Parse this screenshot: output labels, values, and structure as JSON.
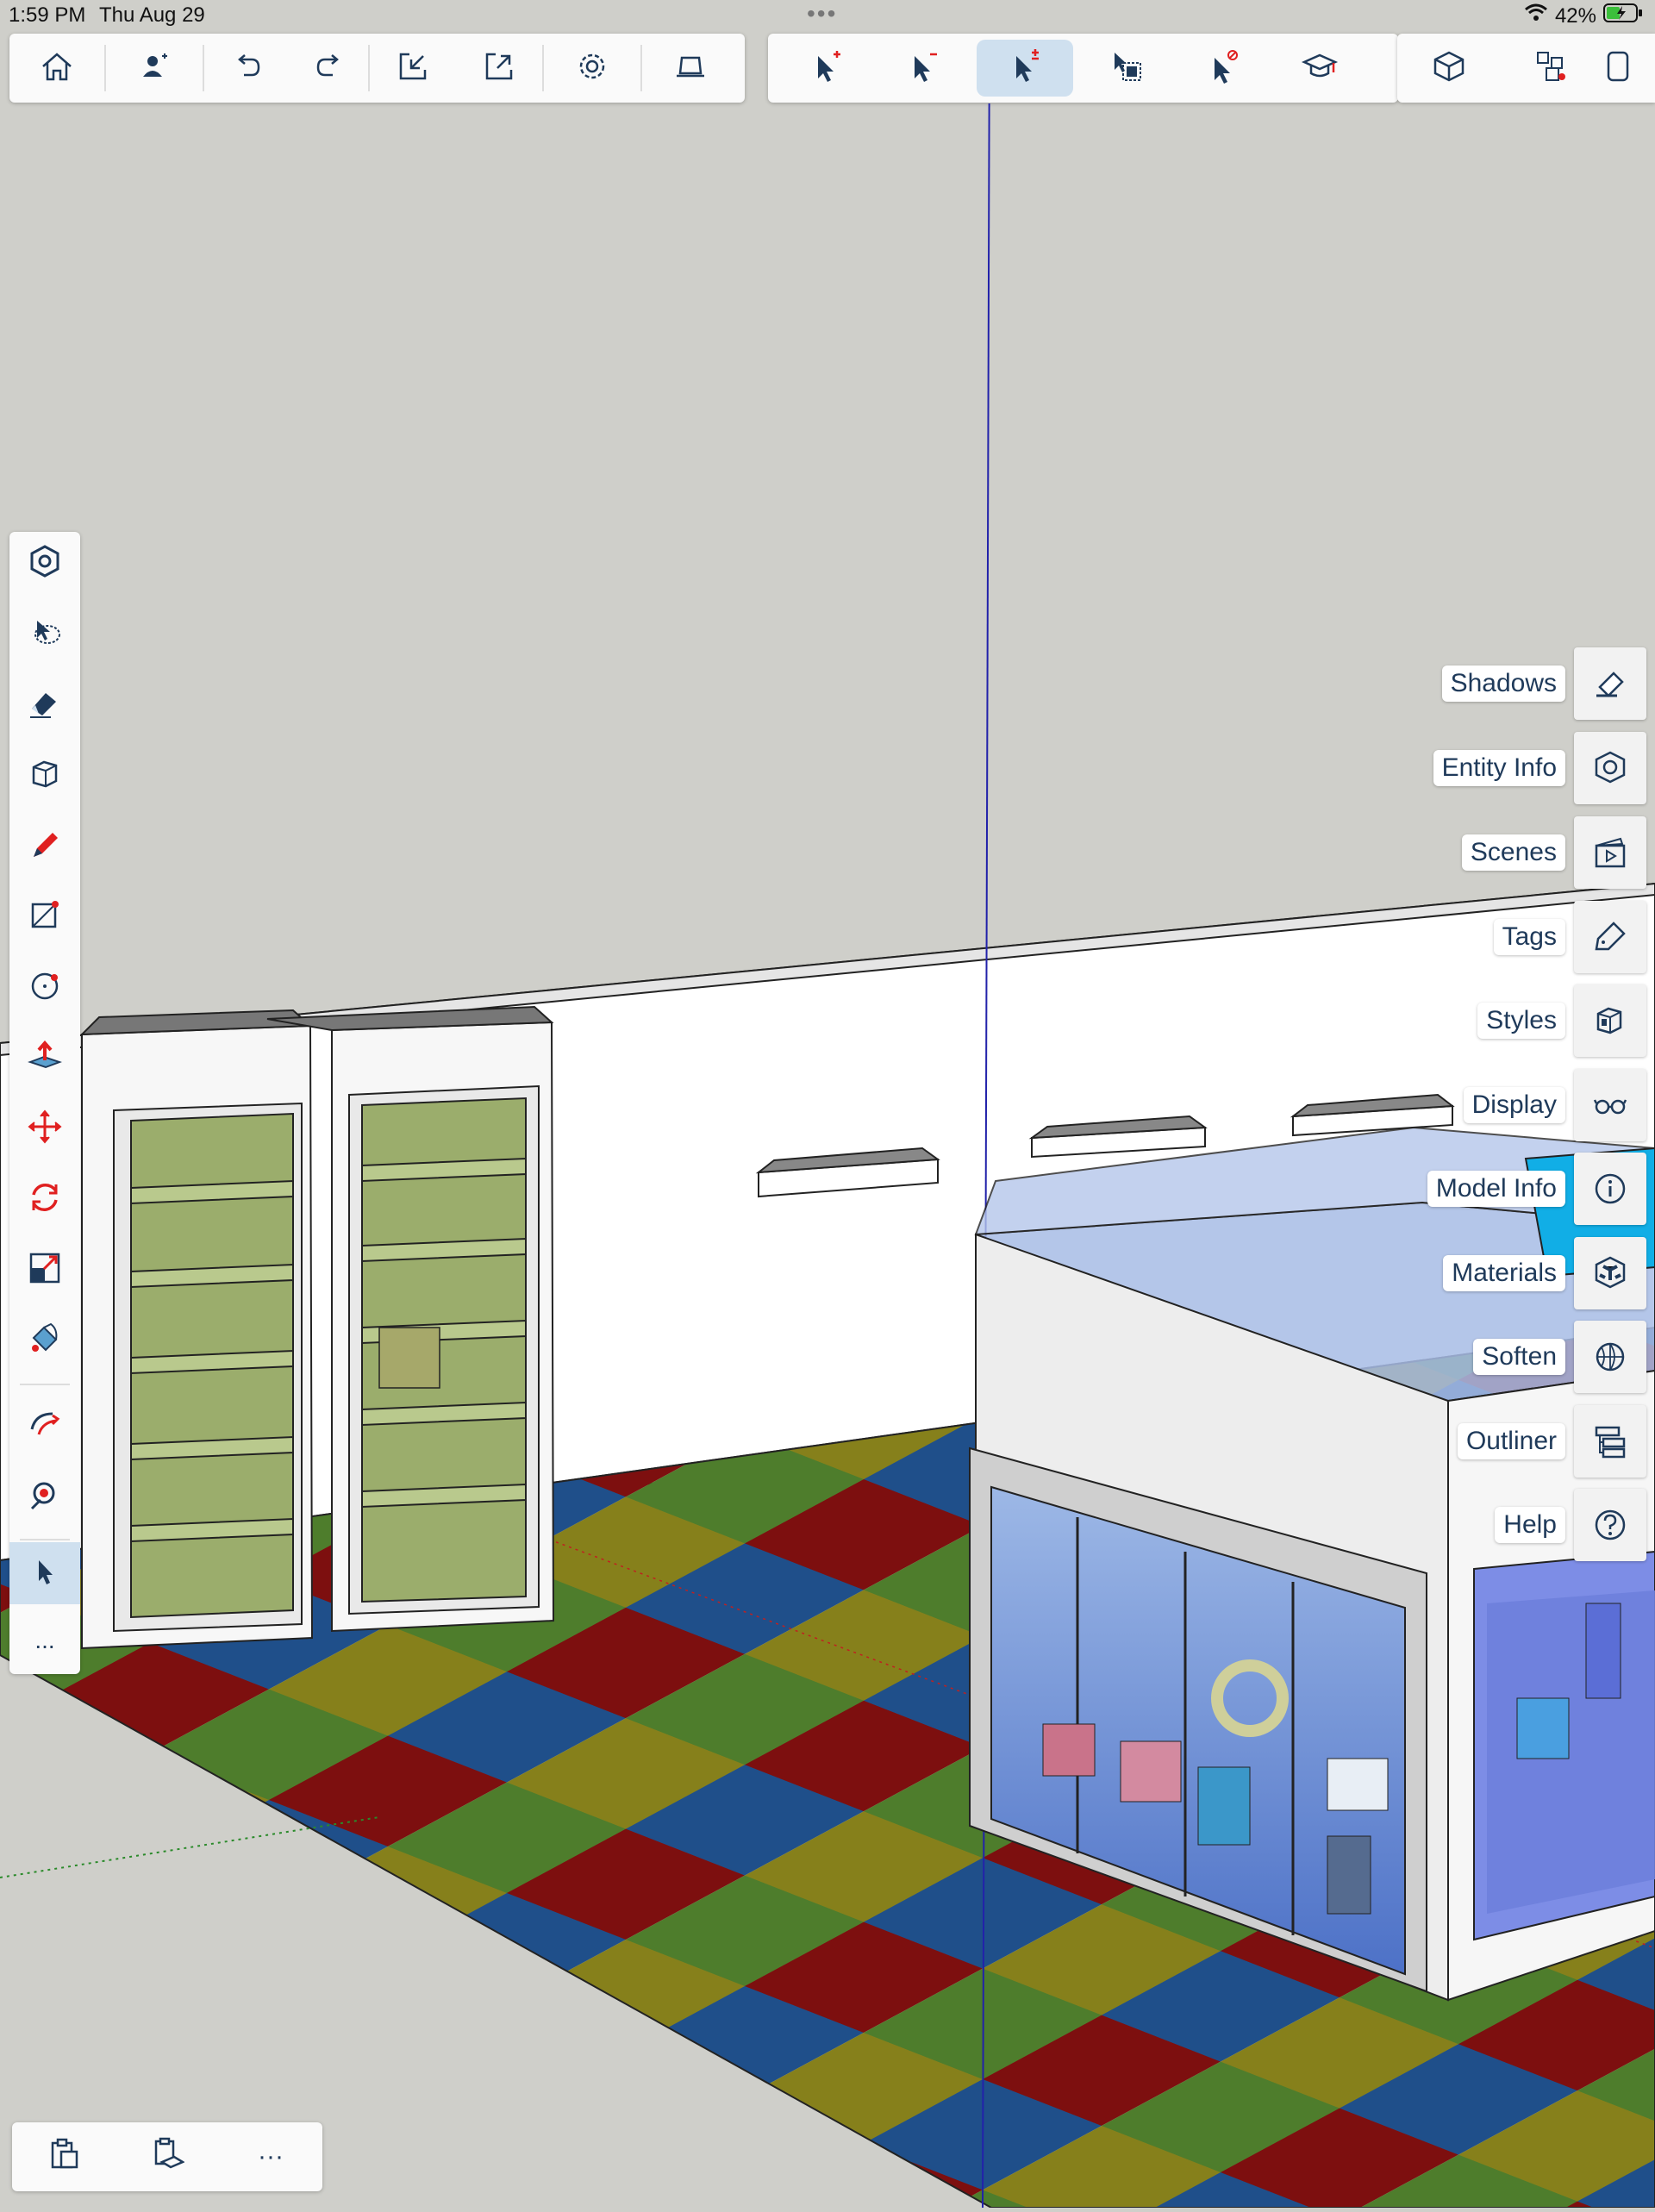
{
  "status_bar": {
    "time": "1:59 PM",
    "date": "Thu Aug 29",
    "multitask_dots": "•••",
    "battery_percent": "42%"
  },
  "top_toolbar": {
    "group1": [
      "home-icon",
      "add-person-icon",
      "undo-icon",
      "redo-icon",
      "import-icon",
      "export-icon",
      "settings-icon",
      "laptop-icon"
    ],
    "group2": [
      "select-add-icon",
      "select-subtract-icon",
      "select-toggle-icon",
      "select-window-icon",
      "select-deny-icon",
      "teach-icon"
    ],
    "group3": [
      "component-icon",
      "components-icon",
      "library-icon"
    ],
    "active": "select-toggle-icon"
  },
  "left_toolbar": {
    "tools": [
      "tool-modifier-icon",
      "lasso-select-icon",
      "eraser-icon",
      "box-icon",
      "pencil-icon",
      "rectangle-icon",
      "circle-icon",
      "push-pull-icon",
      "move-icon",
      "rotate-icon",
      "scale-icon",
      "paint-bucket-icon",
      "follow-me-icon",
      "position-camera-icon",
      "select-icon",
      "more-icon"
    ],
    "more_label": "...",
    "active": "select-icon"
  },
  "right_panel": {
    "items": [
      {
        "label": "Shadows",
        "icon": "shadows-icon"
      },
      {
        "label": "Entity Info",
        "icon": "entity-info-icon"
      },
      {
        "label": "Scenes",
        "icon": "scenes-icon"
      },
      {
        "label": "Tags",
        "icon": "tags-icon"
      },
      {
        "label": "Styles",
        "icon": "styles-icon"
      },
      {
        "label": "Display",
        "icon": "display-icon"
      },
      {
        "label": "Model Info",
        "icon": "model-info-icon"
      },
      {
        "label": "Materials",
        "icon": "materials-icon"
      },
      {
        "label": "Soften",
        "icon": "soften-icon"
      },
      {
        "label": "Outliner",
        "icon": "outliner-icon"
      },
      {
        "label": "Help",
        "icon": "help-icon"
      }
    ]
  },
  "bottom_toolbar": {
    "items": [
      "clipboard-icon",
      "paste-in-place-icon",
      "more-icon"
    ],
    "more_label": "···"
  },
  "colors": {
    "accent": "#1f3a5a",
    "active_bg": "#cfe0ef",
    "mat_red": "#7d0f0f",
    "mat_green": "#4e7d2c",
    "mat_blue": "#1f4f8a",
    "mat_yellow": "#86801b"
  }
}
